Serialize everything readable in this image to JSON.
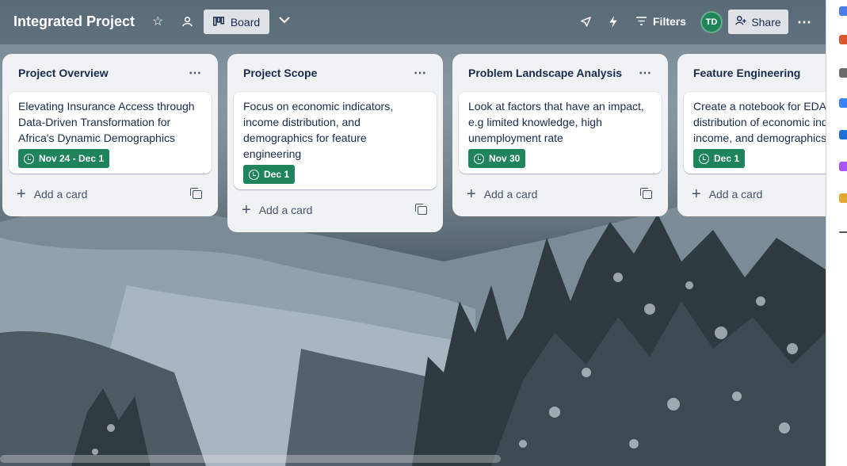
{
  "header": {
    "board_title": "Integrated Project",
    "view_label": "Board",
    "filters_label": "Filters",
    "share_label": "Share",
    "avatar_initials": "TD",
    "icons": [
      "star-icon",
      "workspace-visibility-icon",
      "board-view-icon",
      "chevron-down-icon",
      "rocket-icon",
      "automation-bolt-icon",
      "filter-icon",
      "share-user-icon",
      "more-icon"
    ]
  },
  "lists": [
    {
      "title": "Project Overview",
      "cards": [
        {
          "text": "Elevating Insurance Access through Data-Driven Transformation for Africa's Dynamic Demographics",
          "due": "Nov 24 - Dec 1"
        }
      ],
      "add_card_label": "Add a card"
    },
    {
      "title": "Project Scope",
      "cards": [
        {
          "text": "Focus on economic indicators, income distribution, and demographics for feature engineering",
          "due": "Dec 1"
        }
      ],
      "add_card_label": "Add a card"
    },
    {
      "title": "Problem Landscape Analysis",
      "cards": [
        {
          "text": "Look at factors that have an impact, e.g limited knowledge, high unemployment rate",
          "due": "Nov 30"
        }
      ],
      "add_card_label": "Add a card"
    },
    {
      "title": "Feature Engineering",
      "cards": [
        {
          "text": "Create a notebook for EDA, the distribution of economic indicators, income, and demographics.",
          "due": "Dec 1"
        }
      ],
      "add_card_label": "Add a card"
    }
  ],
  "colors": {
    "due_badge": "#1f845a",
    "list_bg": "#f1f2f4",
    "avatar_bg": "#1f845a"
  }
}
